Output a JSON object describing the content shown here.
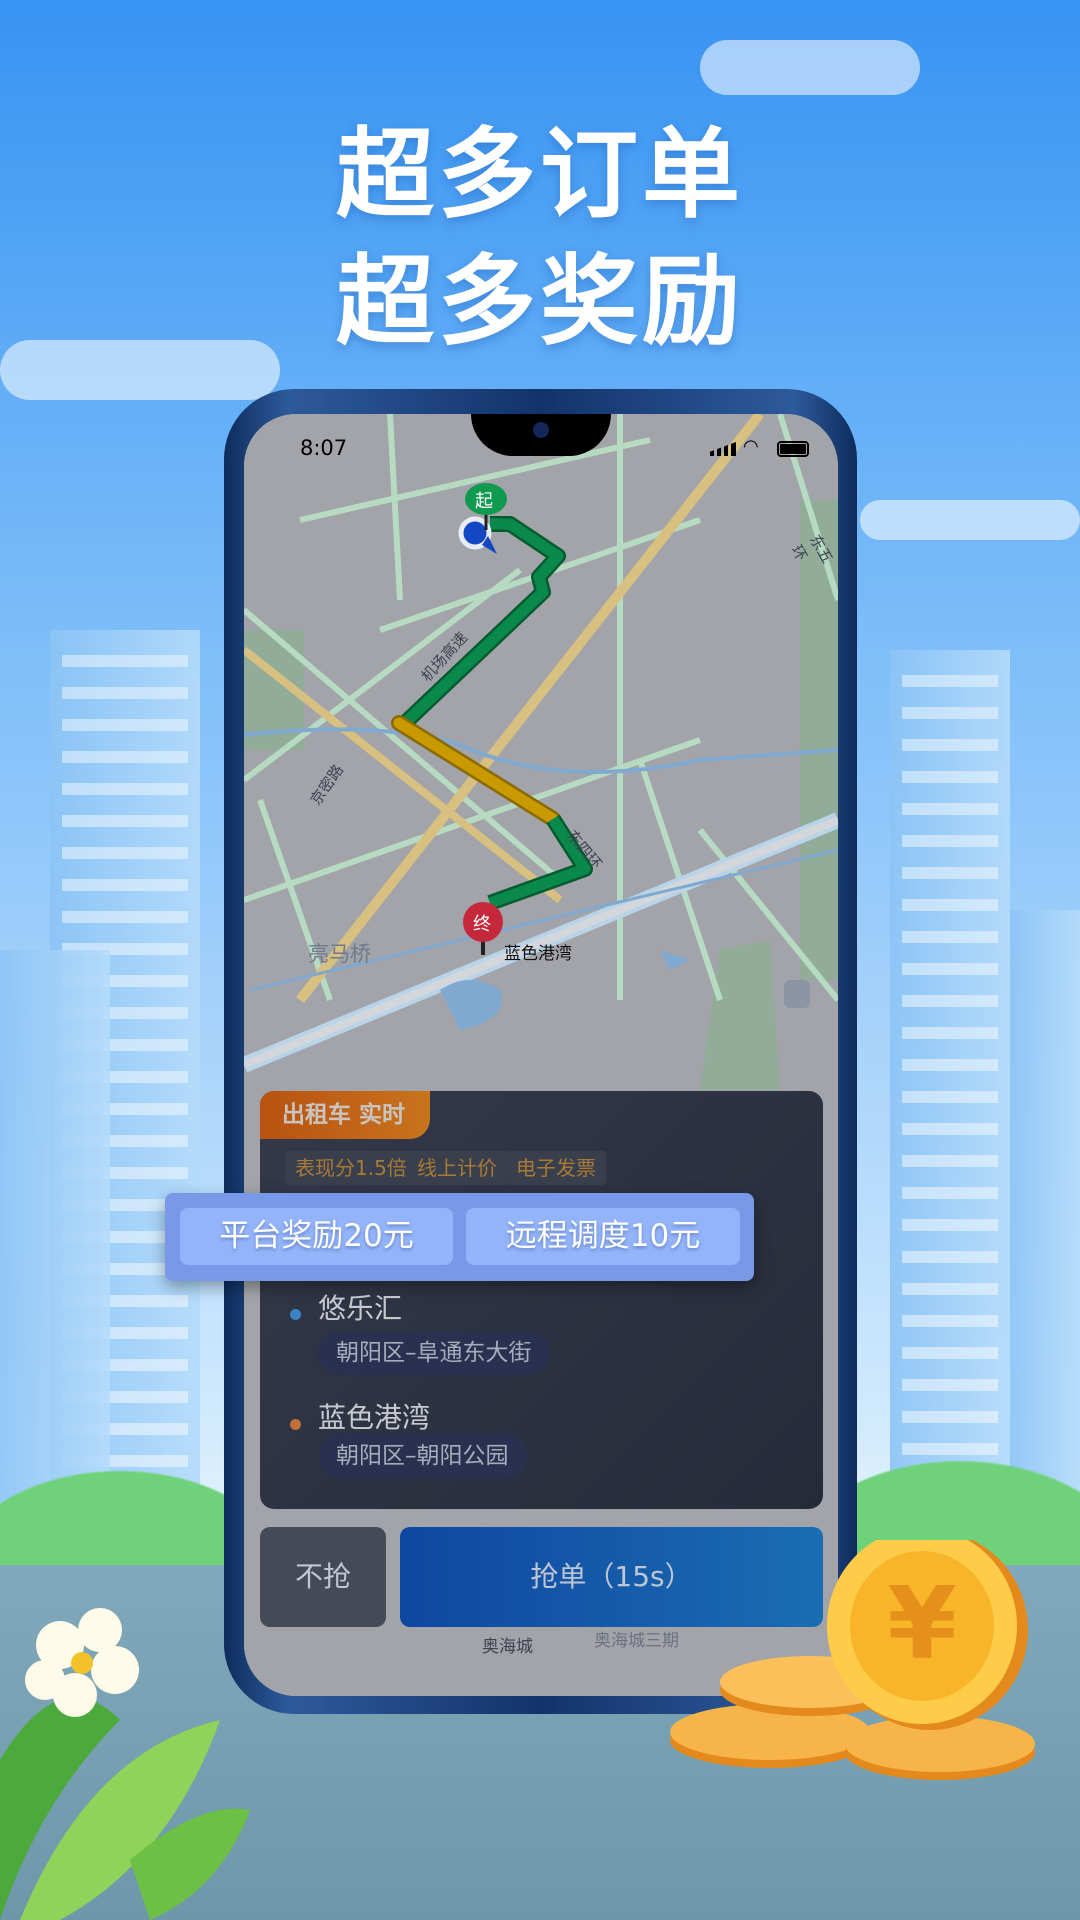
{
  "headline": {
    "line1": "超多订单",
    "line2": "超多奖励"
  },
  "status_bar": {
    "time": "8:07",
    "icons": [
      "signal-icon",
      "wifi-icon",
      "battery-icon"
    ]
  },
  "map": {
    "start_marker": "起",
    "end_marker": "终",
    "labels": {
      "destination": "蓝色港湾",
      "area": "亮马桥",
      "road1": "机场高速",
      "road2": "京密路",
      "road3": "东四环",
      "road4": "东五环",
      "bottom": "奥海城",
      "bottom2": "奥海城三期"
    },
    "route_colors": {
      "smooth": "#0a8a4a",
      "slow": "#c89a00"
    }
  },
  "order_card": {
    "type_tag": "出租车 实时",
    "chips": [
      "表现分1.5倍",
      "线上计价",
      "电子发票"
    ],
    "rewards": [
      "平台奖励20元",
      "远程调度10元"
    ],
    "pickup": {
      "name": "悠乐汇",
      "address": "朝阳区–阜通东大街",
      "dot_color": "#3b82c4"
    },
    "dropoff": {
      "name": "蓝色港湾",
      "address": "朝阳区–朝阳公园",
      "dot_color": "#c2703a"
    }
  },
  "actions": {
    "decline": "不抢",
    "accept": "抢单（15s）"
  }
}
